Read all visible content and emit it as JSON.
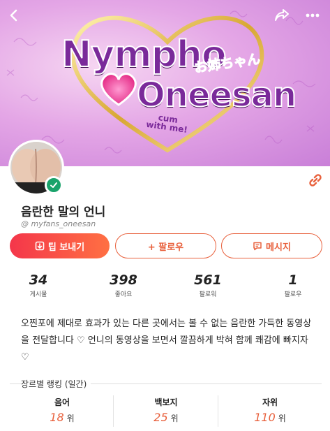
{
  "banner": {
    "logo_line1": "Nympho",
    "logo_line2": "Oneesan",
    "logo_jp": "お姉ちゃん",
    "logo_tag": "cum with me!"
  },
  "profile": {
    "display_name": "음란한 말의 언니",
    "handle": "@ myfans_oneesan"
  },
  "actions": {
    "tip_label": "팁 보내기",
    "follow_label": "+ 팔로우",
    "message_label": "메시지"
  },
  "stats": [
    {
      "value": "34",
      "label": "게시물"
    },
    {
      "value": "398",
      "label": "좋아요"
    },
    {
      "value": "561",
      "label": "팔로워"
    },
    {
      "value": "1",
      "label": "팔로우"
    }
  ],
  "bio": "오찐포에 제대로 효과가 있는 다른 곳에서는 볼 수 없는 음란한 가득한 동영상을 전달합니다 ♡ 언니의 동영상을 보면서 깔끔하게 박혀 함께 쾌감에 빠지자 ♡",
  "ranking": {
    "title": "장르별 랭킹 (일간)",
    "unit": "위",
    "items": [
      {
        "category": "음어",
        "rank": "18"
      },
      {
        "category": "백보지",
        "rank": "25"
      },
      {
        "category": "자위",
        "rank": "110"
      }
    ]
  },
  "colors": {
    "accent": "#e8603c",
    "tip_gradient_start": "#f4364a",
    "tip_gradient_end": "#ff7043",
    "verified": "#1aa36b",
    "logo_purple": "#7a2a9a"
  }
}
